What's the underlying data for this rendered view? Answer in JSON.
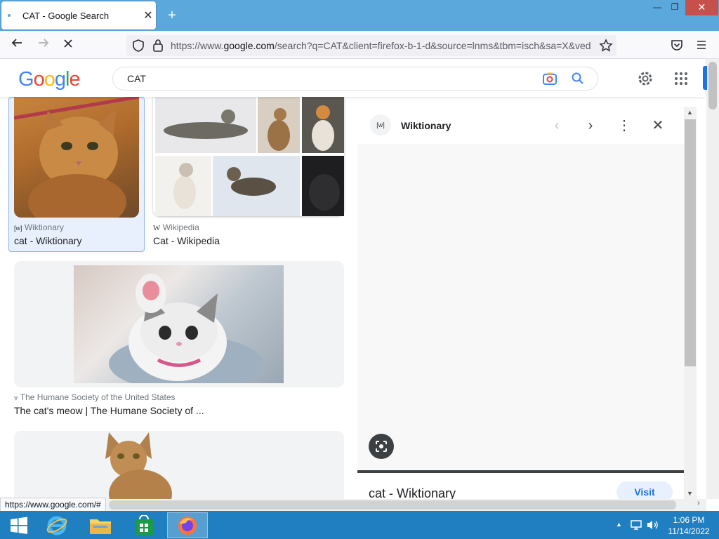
{
  "browser": {
    "tab_title": "CAT - Google Search",
    "tab_close": "✕",
    "new_tab": "+",
    "url_prefix": "https://www.",
    "url_domain": "google.com",
    "url_rest": "/search?q=CAT&client=firefox-b-1-d&source=lnms&tbm=isch&sa=X&ved",
    "status_url": "https://www.google.com/#",
    "win_minimize": "—",
    "win_restore": "❐",
    "win_close": "✕"
  },
  "google": {
    "logo_letters": [
      "G",
      "o",
      "o",
      "g",
      "l",
      "e"
    ],
    "logo_colors": [
      "#4285f4",
      "#ea4335",
      "#fbbc05",
      "#4285f4",
      "#34a853",
      "#ea4335"
    ],
    "query": "CAT"
  },
  "results": [
    {
      "source": "Wiktionary",
      "favicon": "[w]",
      "title": "cat - Wiktionary"
    },
    {
      "source": "Wikipedia",
      "favicon": "W",
      "title": "Cat - Wikipedia"
    },
    {
      "source": "The Humane Society of the United States",
      "favicon": "⩔",
      "title": "The cat's meow | The Humane Society of ..."
    }
  ],
  "panel": {
    "favicon": "[w]",
    "source": "Wiktionary",
    "prev": "‹",
    "next": "›",
    "more": "⋮",
    "close": "✕",
    "title": "cat - Wiktionary",
    "visit": "Visit"
  },
  "taskbar": {
    "time": "1:06 PM",
    "date": "11/14/2022"
  }
}
